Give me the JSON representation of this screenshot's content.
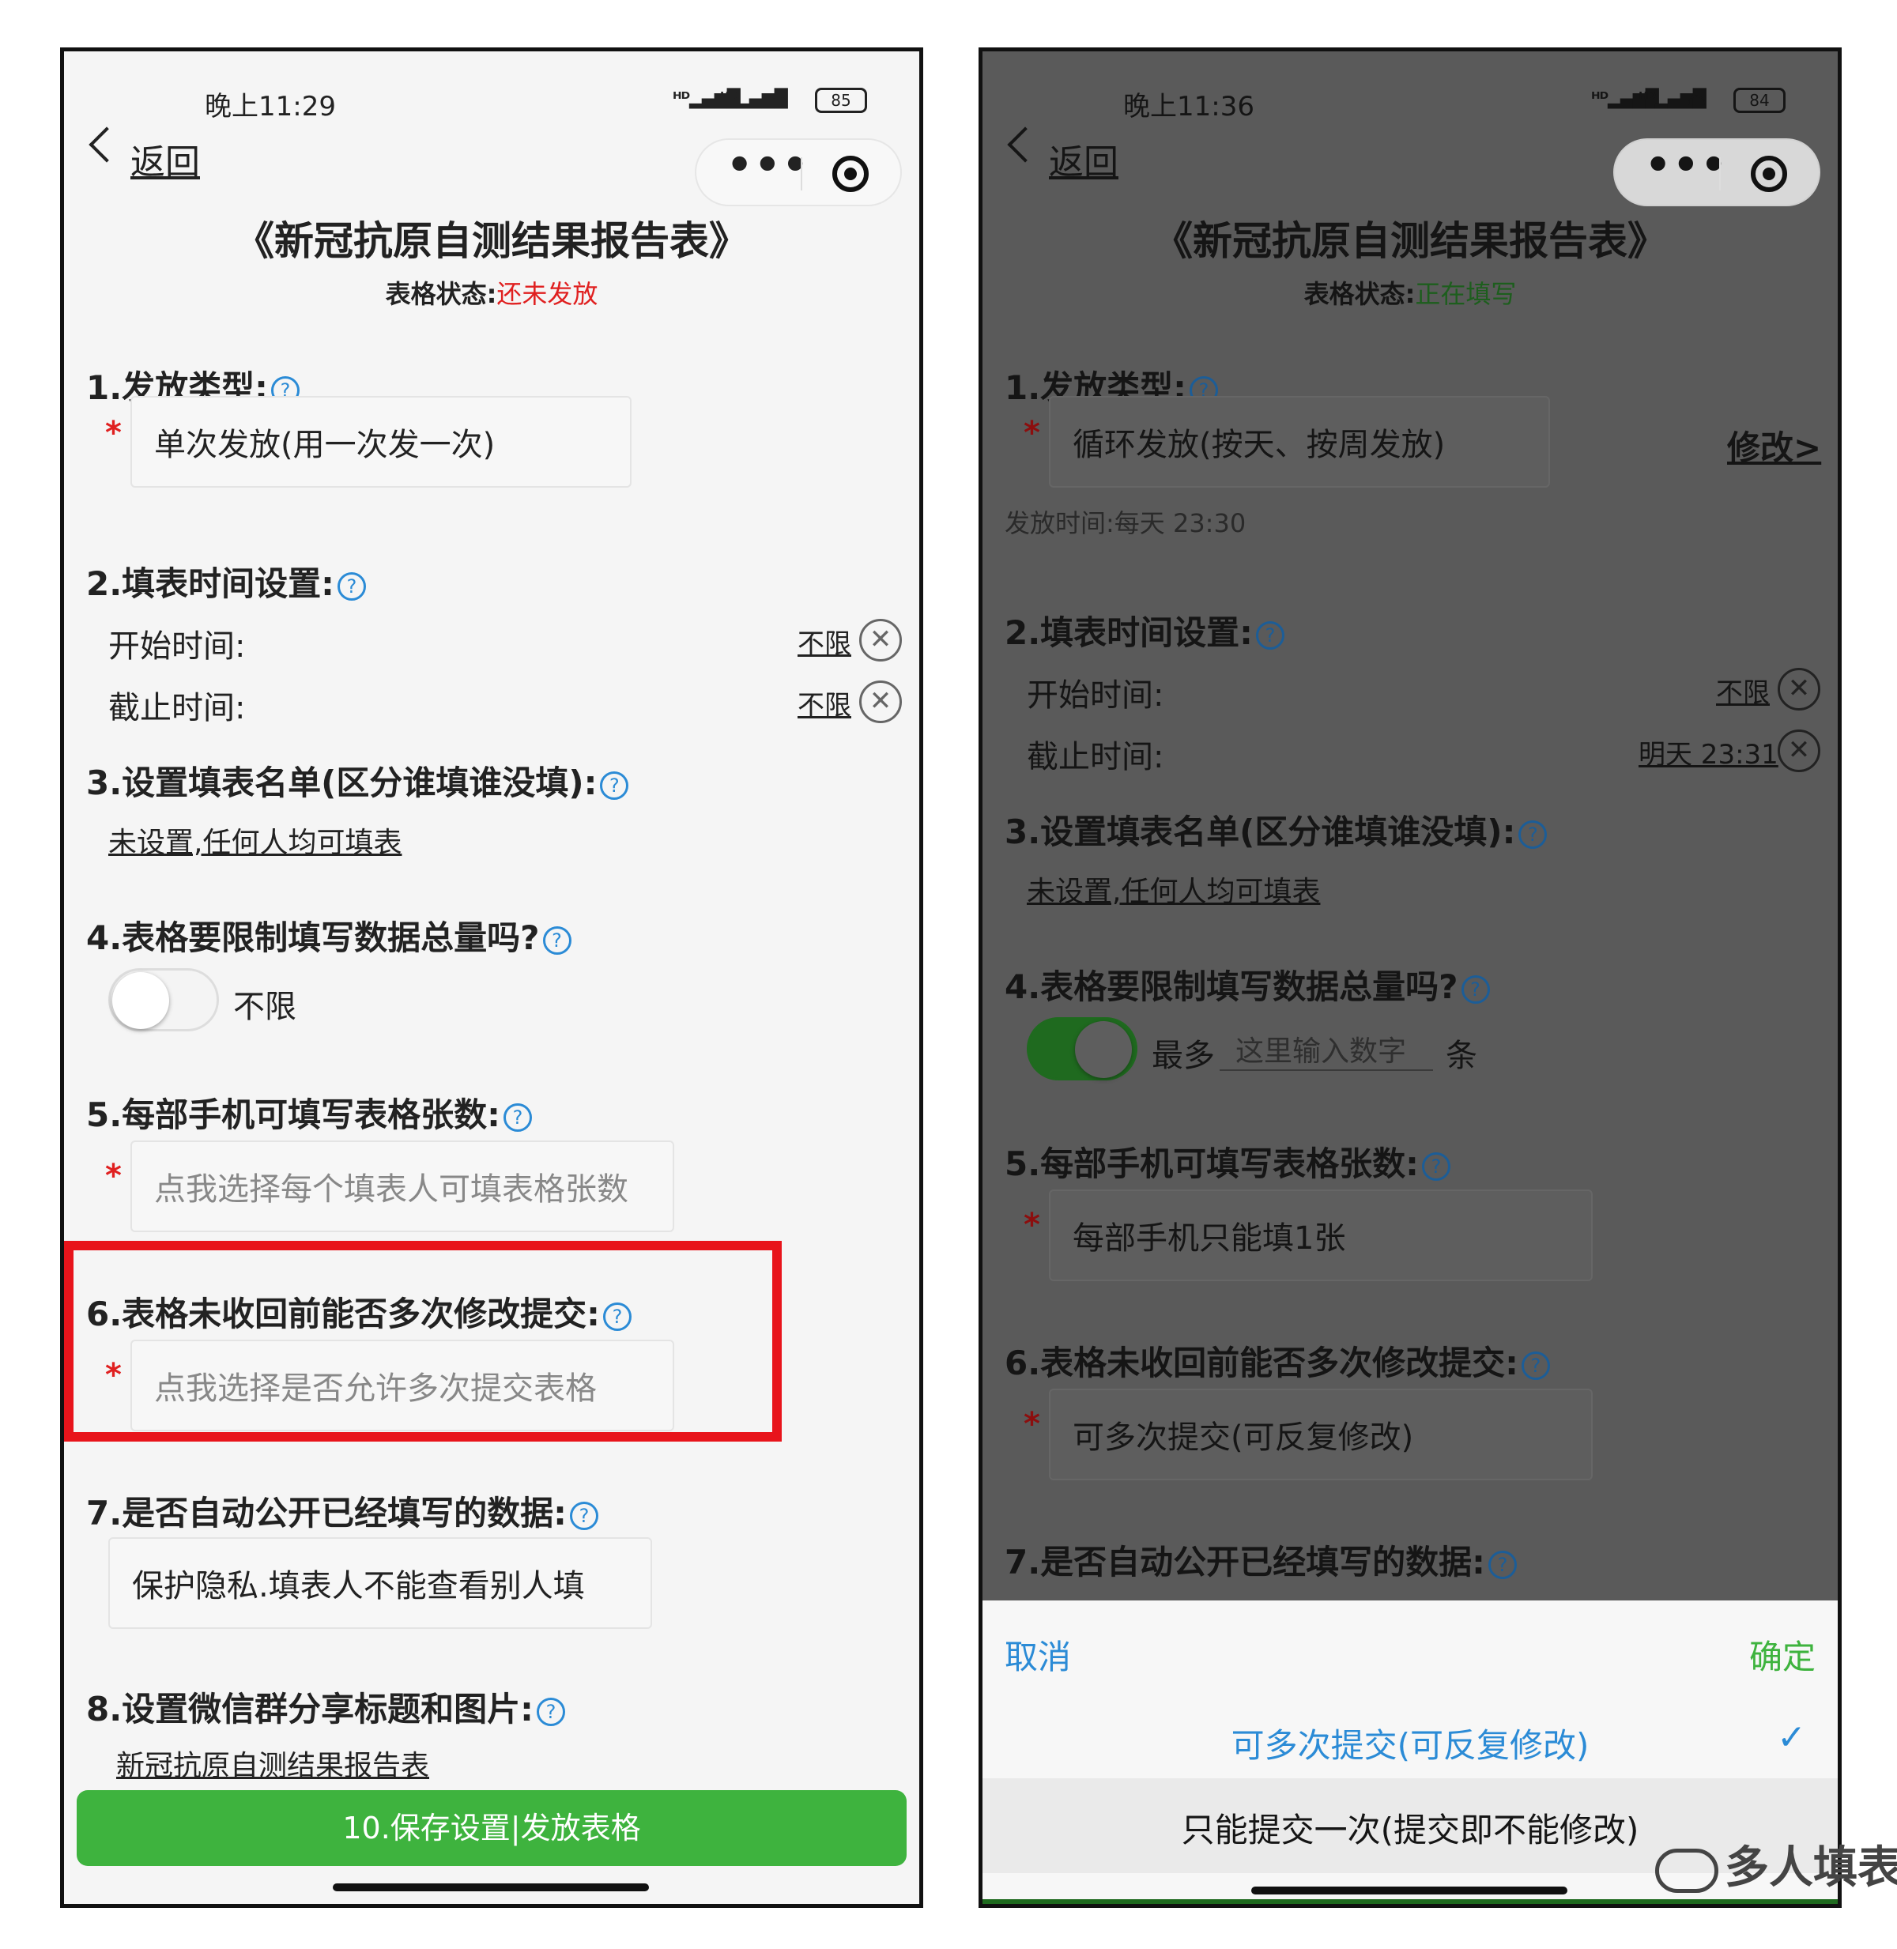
{
  "left": {
    "status_time": "晚上11:29",
    "battery": "85",
    "back_label": "返回",
    "capsule_more": "•••",
    "title": "《新冠抗原自测结果报告表》",
    "state_label": "表格状态:",
    "state_value": "还未发放",
    "s1_title": "1.发放类型:",
    "s1_value": "单次发放(用一次发一次)",
    "s2_title": "2.填表时间设置:",
    "start_label": "开始时间:",
    "start_value": "不限",
    "end_label": "截止时间:",
    "end_value": "不限",
    "s3_title": "3.设置填表名单(区分谁填谁没填):",
    "s3_link": "未设置,任何人均可填表",
    "s4_title": "4.表格要限制填写数据总量吗?",
    "s4_text": "不限",
    "s5_title": "5.每部手机可填写表格张数:",
    "s5_placeholder": "点我选择每个填表人可填表格张数",
    "s6_title": "6.表格未收回前能否多次修改提交:",
    "s6_placeholder": "点我选择是否允许多次提交表格",
    "s7_title": "7.是否自动公开已经填写的数据:",
    "s7_value": "保护隐私.填表人不能查看别人填",
    "s8_title": "8.设置微信群分享标题和图片:",
    "s8_link": "新冠抗原自测结果报告表",
    "save_button": "10.保存设置|发放表格"
  },
  "right": {
    "status_time": "晚上11:36",
    "battery": "84",
    "back_label": "返回",
    "capsule_more": "•••",
    "title": "《新冠抗原自测结果报告表》",
    "state_label": "表格状态:",
    "state_value": "正在填写",
    "s1_title": "1.发放类型:",
    "s1_value": "循环发放(按天、按周发放)",
    "s1_edit": "修改",
    "s1_note": "发放时间:每天 23:30",
    "s2_title": "2.填表时间设置:",
    "start_label": "开始时间:",
    "start_value": "不限",
    "end_label": "截止时间:",
    "end_value": "明天 23:31",
    "s3_title": "3.设置填表名单(区分谁填谁没填):",
    "s3_link": "未设置,任何人均可填表",
    "s4_title": "4.表格要限制填写数据总量吗?",
    "s4_prefix": "最多",
    "s4_placeholder": "这里输入数字",
    "s4_suffix": "条",
    "s5_title": "5.每部手机可填写表格张数:",
    "s5_value": "每部手机只能填1张",
    "s6_title": "6.表格未收回前能否多次修改提交:",
    "s6_value": "可多次提交(可反复修改)",
    "s7_title": "7.是否自动公开已经填写的数据:",
    "picker_cancel": "取消",
    "picker_confirm": "确定",
    "picker_option1": "可多次提交(可反复修改)",
    "picker_option2": "只能提交一次(提交即不能修改)",
    "watermark": "多人填表"
  },
  "colors": {
    "accent_green": "#3eb33e",
    "state_red": "#e02020",
    "picker_blue": "#2b8bd6"
  }
}
